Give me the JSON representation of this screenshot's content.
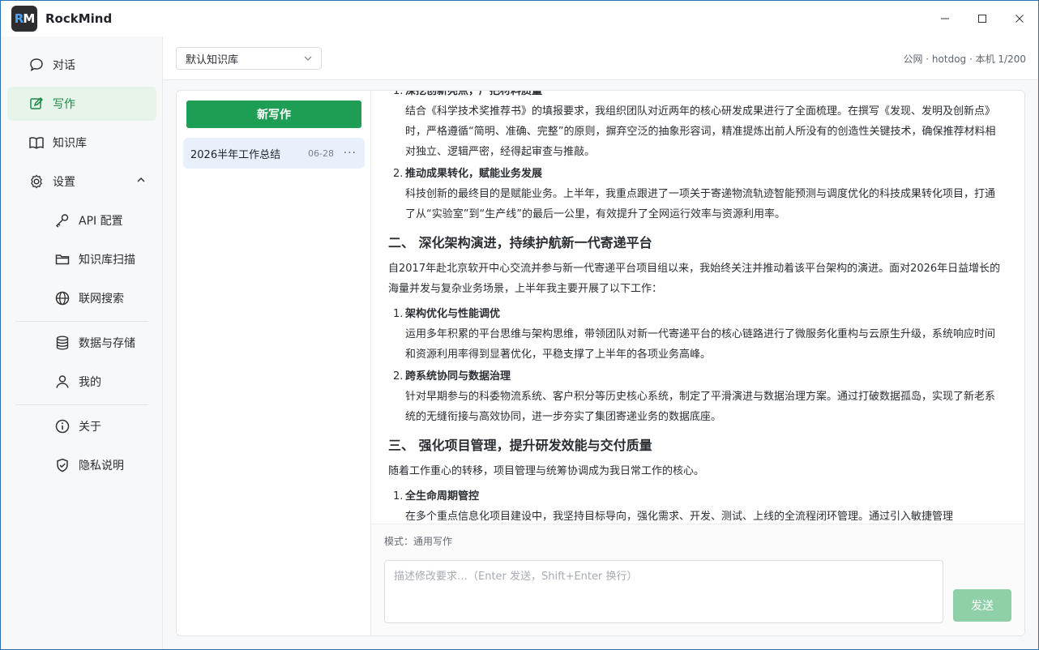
{
  "app": {
    "title": "RockMind",
    "logo_r": "R",
    "logo_m": "M"
  },
  "window_controls": {
    "minimize": "—",
    "maximize": "☐",
    "close": "✕"
  },
  "sidebar": {
    "items": [
      {
        "label": "对话",
        "icon": "chat-icon"
      },
      {
        "label": "写作",
        "icon": "edit-icon",
        "active": true
      },
      {
        "label": "知识库",
        "icon": "book-icon"
      },
      {
        "label": "设置",
        "icon": "gear-icon",
        "expanded": true
      },
      {
        "label": "API 配置",
        "icon": "key-icon"
      },
      {
        "label": "知识库扫描",
        "icon": "folder-icon"
      },
      {
        "label": "联网搜索",
        "icon": "globe-icon"
      },
      {
        "label": "数据与存储",
        "icon": "database-icon"
      },
      {
        "label": "我的",
        "icon": "user-icon"
      },
      {
        "label": "关于",
        "icon": "info-icon"
      },
      {
        "label": "隐私说明",
        "icon": "shield-icon"
      }
    ]
  },
  "topbar": {
    "knowledge_base": "默认知识库",
    "status": "公网 · hotdog · 本机 1/200"
  },
  "doc_list": {
    "new_button": "新写作",
    "items": [
      {
        "title": "2026半年工作总结",
        "date": "06-28",
        "more": "···"
      }
    ]
  },
  "document": {
    "top_item": {
      "num": "1.",
      "title": "深挖创新亮点，严把材料质量",
      "body": "结合《科学技术奖推荐书》的填报要求，我组织团队对近两年的核心研发成果进行了全面梳理。在撰写《发现、发明及创新点》时，严格遵循“简明、准确、完整”的原则，摒弃空泛的抽象形容词，精准提炼出前人所没有的创造性关键技术，确保推荐材料相对独立、逻辑严密，经得起审查与推敲。"
    },
    "item2": {
      "num": "2.",
      "title": "推动成果转化，赋能业务发展",
      "body": "科技创新的最终目的是赋能业务。上半年，我重点跟进了一项关于寄递物流轨迹智能预测与调度优化的科技成果转化项目，打通了从“实验室”到“生产线”的最后一公里，有效提升了全网运行效率与资源利用率。"
    },
    "section2": {
      "heading": "二、 深化架构演进，持续护航新一代寄递平台",
      "intro": "自2017年赴北京软开中心交流并参与新一代寄递平台项目组以来，我始终关注并推动着该平台架构的演进。面对2026年日益增长的海量并发与复杂业务场景，上半年我主要开展了以下工作：",
      "items": [
        {
          "num": "1.",
          "title": "架构优化与性能调优",
          "body": "运用多年积累的平台思维与架构思维，带领团队对新一代寄递平台的核心链路进行了微服务化重构与云原生升级，系统响应时间和资源利用率得到显著优化，平稳支撑了上半年的各项业务高峰。"
        },
        {
          "num": "2.",
          "title": "跨系统协同与数据治理",
          "body": "针对早期参与的科委物流系统、客户积分等历史核心系统，制定了平滑演进与数据治理方案。通过打破数据孤岛，实现了新老系统的无缝衔接与高效协同，进一步夯实了集团寄递业务的数据底座。"
        }
      ]
    },
    "section3": {
      "heading": "三、 强化项目管理，提升研发效能与交付质量",
      "intro": "随着工作重心的转移，项目管理与统筹协调成为我日常工作的核心。",
      "items": [
        {
          "num": "1.",
          "title": "全生命周期管控",
          "body": "在多个重点信息化项目建设中，我坚持目标导向，强化需求、开发、测试、上线的全流程闭环管理。通过引入敏捷管理"
        }
      ]
    }
  },
  "compose": {
    "mode": "模式：通用写作",
    "placeholder": "描述修改要求…（Enter 发送，Shift+Enter 换行）",
    "send": "发送"
  }
}
